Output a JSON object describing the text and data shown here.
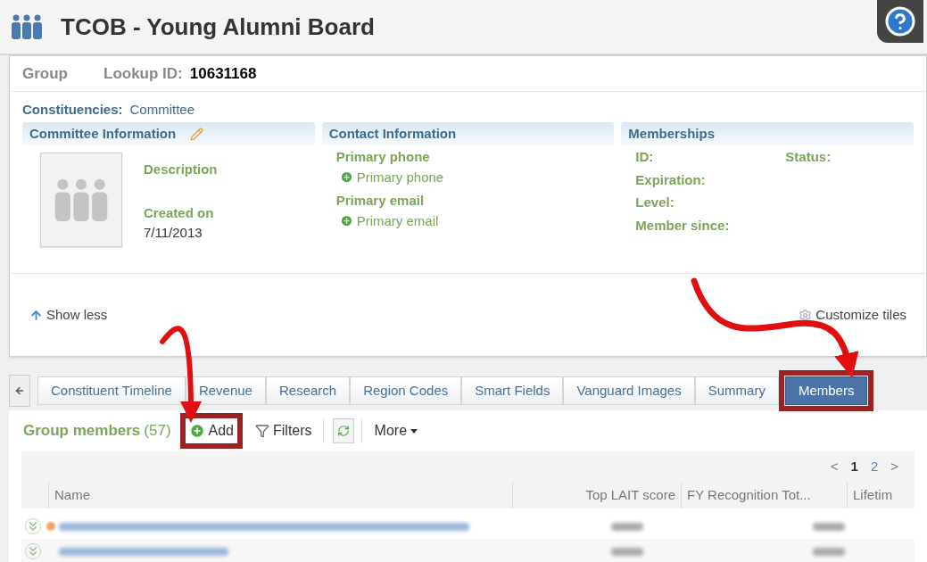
{
  "header": {
    "title": "TCOB - Young Alumni Board"
  },
  "record": {
    "type_label": "Group",
    "lookup_label": "Lookup ID:",
    "lookup_id": "10631168",
    "constituencies_label": "Constituencies:",
    "constituencies_value": "Committee"
  },
  "tiles": [
    {
      "kind": "committee",
      "title": "Committee Information",
      "editable": true,
      "fields": [
        {
          "label": "Description"
        },
        {
          "label": "Created on",
          "value": "7/11/2013"
        }
      ]
    },
    {
      "kind": "contact",
      "title": "Contact Information",
      "fields": [
        {
          "label": "Primary phone",
          "action": "Primary phone"
        },
        {
          "label": "Primary email",
          "action": "Primary email"
        }
      ]
    },
    {
      "kind": "memberships",
      "title": "Memberships",
      "rows": [
        [
          "ID:",
          "Status:"
        ],
        [
          "Expiration:"
        ],
        [
          "Level:"
        ],
        [
          "Member since:"
        ]
      ]
    }
  ],
  "show_less": "Show less",
  "customize_tiles": "Customize tiles",
  "tabs": [
    {
      "label": "Constituent Timeline",
      "selected": false,
      "highlighted": false
    },
    {
      "label": "Revenue",
      "selected": false,
      "highlighted": false
    },
    {
      "label": "Research",
      "selected": false,
      "highlighted": false
    },
    {
      "label": "Region Codes",
      "selected": false,
      "highlighted": false
    },
    {
      "label": "Smart Fields",
      "selected": false,
      "highlighted": false
    },
    {
      "label": "Vanguard Images",
      "selected": false,
      "highlighted": false
    },
    {
      "label": "Summary",
      "selected": false,
      "highlighted": false
    },
    {
      "label": "Members",
      "selected": true,
      "highlighted": true
    }
  ],
  "section": {
    "title": "Group members",
    "count": "(57)"
  },
  "toolbar": [
    {
      "kind": "add",
      "label": "Add",
      "highlighted": true
    },
    {
      "kind": "filter",
      "label": "Filters",
      "highlighted": false
    },
    {
      "kind": "refresh",
      "highlighted": false
    },
    {
      "kind": "menu",
      "label": "More",
      "highlighted": false
    }
  ],
  "pager": {
    "prev": "<",
    "pages": [
      {
        "label": "1",
        "selected": true
      },
      {
        "label": "2",
        "selected": false
      }
    ],
    "next": ">"
  },
  "table": {
    "columns": [
      "Name",
      "Top LAIT score",
      "FY Recognition Tot...",
      "Lifetim"
    ],
    "rows": [
      {
        "flagged": true
      },
      {
        "flagged": false
      }
    ]
  }
}
